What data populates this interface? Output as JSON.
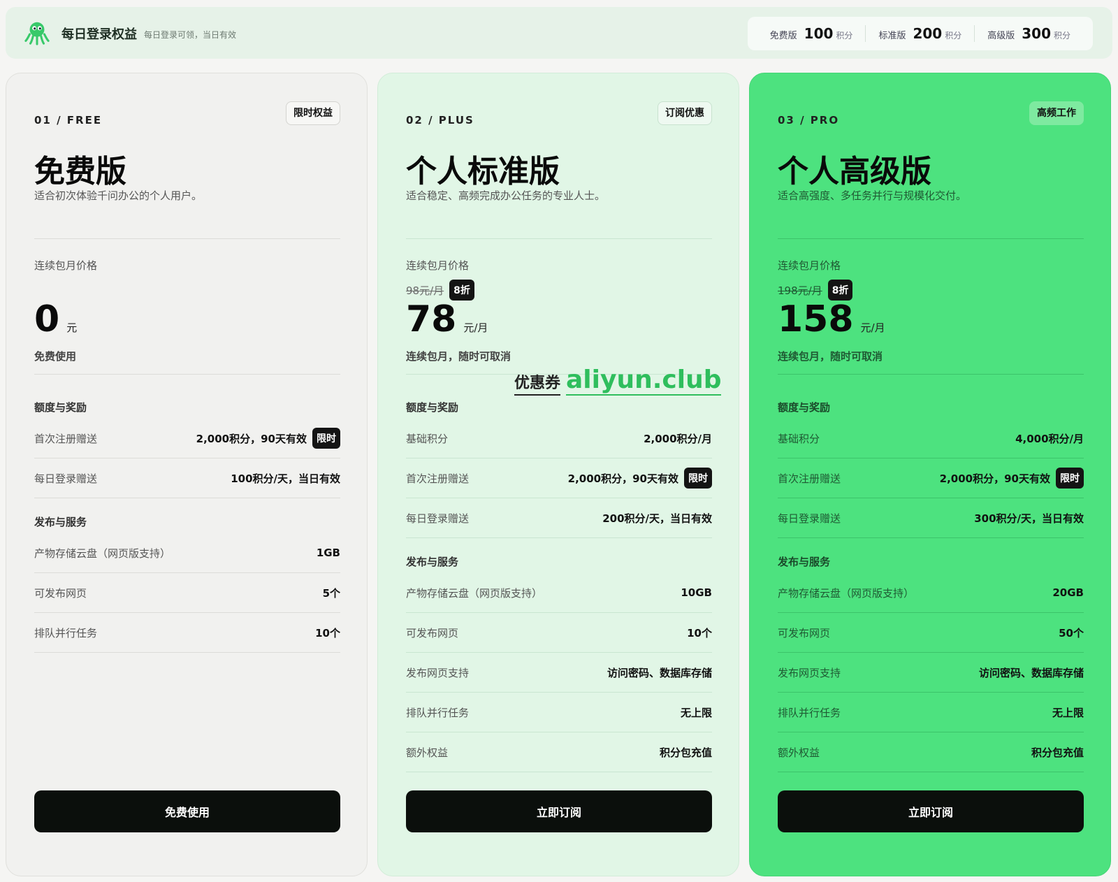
{
  "banner": {
    "title": "每日登录权益",
    "subtitle": "每日登录可领，当日有效",
    "quota": [
      {
        "label": "免费版",
        "value": "100",
        "unit": "积分"
      },
      {
        "label": "标准版",
        "value": "200",
        "unit": "积分"
      },
      {
        "label": "高级版",
        "value": "300",
        "unit": "积分"
      }
    ]
  },
  "coupon": {
    "label": "优惠券",
    "value": "aliyun.club"
  },
  "plans": [
    {
      "tag": "01 / FREE",
      "badge": "限时权益",
      "name": "免费版",
      "desc": "适合初次体验千问办公的个人用户。",
      "price_label": "连续包月价格",
      "price": "0",
      "price_unit": "元",
      "price_note": "免费使用",
      "section_quota": "额度与奖励",
      "quota_rows": [
        {
          "label": "首次注册赠送",
          "value": "2,000积分，90天有效",
          "limit": "限时"
        },
        {
          "label": "每日登录赠送",
          "value": "100积分/天，当日有效"
        }
      ],
      "section_service": "发布与服务",
      "service_rows": [
        {
          "label": "产物存储云盘（网页版支持）",
          "value": "1GB"
        },
        {
          "label": "可发布网页",
          "value": "5个"
        },
        {
          "label": "排队并行任务",
          "value": "10个"
        }
      ],
      "cta": "免费使用"
    },
    {
      "tag": "02 / PLUS",
      "badge": "订阅优惠",
      "name": "个人标准版",
      "desc": "适合稳定、高频完成办公任务的专业人士。",
      "price_label": "连续包月价格",
      "orig_price": "98元/月",
      "discount": "8折",
      "price": "78",
      "price_unit": "元/月",
      "price_note": "连续包月，随时可取消",
      "section_quota": "额度与奖励",
      "quota_rows": [
        {
          "label": "基础积分",
          "value": "2,000积分/月"
        },
        {
          "label": "首次注册赠送",
          "value": "2,000积分，90天有效",
          "limit": "限时"
        },
        {
          "label": "每日登录赠送",
          "value": "200积分/天，当日有效"
        }
      ],
      "section_service": "发布与服务",
      "service_rows": [
        {
          "label": "产物存储云盘（网页版支持）",
          "value": "10GB"
        },
        {
          "label": "可发布网页",
          "value": "10个"
        },
        {
          "label": "发布网页支持",
          "value": "访问密码、数据库存储"
        },
        {
          "label": "排队并行任务",
          "value": "无上限"
        },
        {
          "label": "额外权益",
          "value": "积分包充值"
        }
      ],
      "cta": "立即订阅"
    },
    {
      "tag": "03 / PRO",
      "badge": "高频工作",
      "name": "个人高级版",
      "desc": "适合高强度、多任务并行与规模化交付。",
      "price_label": "连续包月价格",
      "orig_price": "198元/月",
      "discount": "8折",
      "price": "158",
      "price_unit": "元/月",
      "price_note": "连续包月，随时可取消",
      "section_quota": "额度与奖励",
      "quota_rows": [
        {
          "label": "基础积分",
          "value": "4,000积分/月"
        },
        {
          "label": "首次注册赠送",
          "value": "2,000积分，90天有效",
          "limit": "限时"
        },
        {
          "label": "每日登录赠送",
          "value": "300积分/天，当日有效"
        }
      ],
      "section_service": "发布与服务",
      "service_rows": [
        {
          "label": "产物存储云盘（网页版支持）",
          "value": "20GB"
        },
        {
          "label": "可发布网页",
          "value": "50个"
        },
        {
          "label": "发布网页支持",
          "value": "访问密码、数据库存储"
        },
        {
          "label": "排队并行任务",
          "value": "无上限"
        },
        {
          "label": "额外权益",
          "value": "积分包充值"
        }
      ],
      "cta": "立即订阅"
    }
  ]
}
